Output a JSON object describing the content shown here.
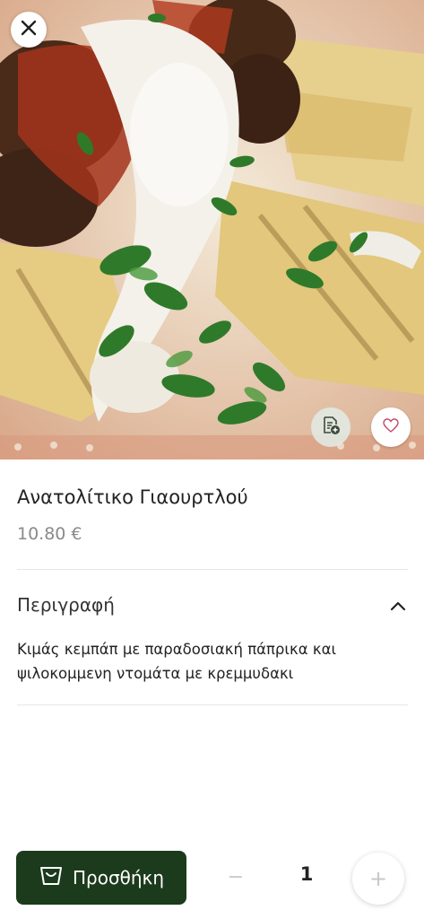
{
  "product": {
    "image_alt": "dish photo",
    "title": "Ανατολίτικο Γιαουρτλού",
    "price": "10.80 €"
  },
  "description": {
    "heading": "Περιγραφή",
    "text": "Κιμάς κεμπάπ με παραδοσιακή πάπρικα και ψιλοκομμενη ντομάτα με κρεμμυδακι",
    "expanded": true
  },
  "cart": {
    "add_label": "Προσθήκη",
    "minus_label": "−",
    "quantity": "1",
    "plus_label": "+"
  },
  "icons": {
    "close": "close-icon",
    "note": "note-add-icon",
    "favorite": "heart-icon",
    "collapse": "chevron-up-icon",
    "basket": "basket-icon"
  },
  "colors": {
    "primary": "#1c3a1c",
    "muted_text": "#8a8a8a"
  }
}
